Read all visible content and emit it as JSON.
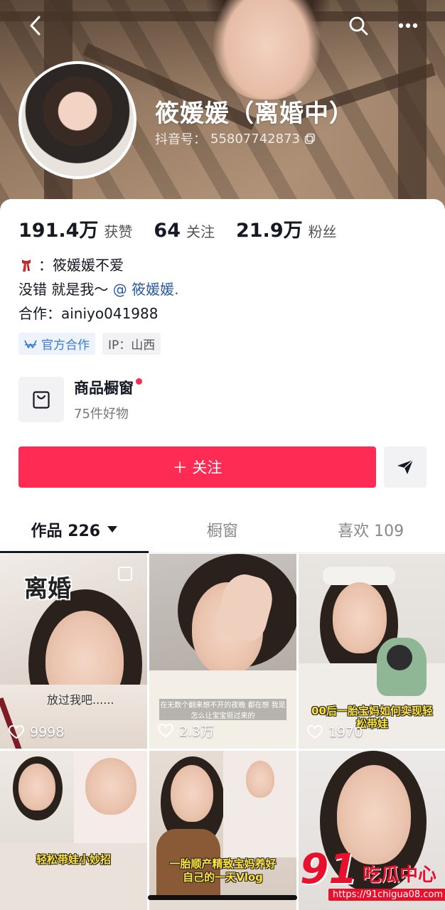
{
  "profile": {
    "name": "筱媛媛（离婚中）",
    "douyin_id_label": "抖音号：",
    "douyin_id": "55807742873"
  },
  "stats": [
    {
      "num": "191.4万",
      "label": "获赞"
    },
    {
      "num": "64",
      "label": "关注"
    },
    {
      "num": "21.9万",
      "label": "粉丝"
    }
  ],
  "bio": {
    "line1": "：筱媛媛不爱",
    "line2_text": "没错 就是我～",
    "line2_mention": "@ 筱媛媛.",
    "line3": "合作：ainiyo041988"
  },
  "tags": {
    "official": "官方合作",
    "ip": "IP：山西"
  },
  "shop": {
    "title": "商品橱窗",
    "subtitle": "75件好物"
  },
  "actions": {
    "follow": "＋ 关注"
  },
  "tabs": [
    {
      "label": "作品 226"
    },
    {
      "label": "橱窗"
    },
    {
      "label": "喜欢 109"
    }
  ],
  "videos": [
    {
      "title": "离婚",
      "caption": "放过我吧......",
      "likes": "9998"
    },
    {
      "caption": "在无数个翻来想不开的夜晚 都在想 我是怎么让宝宝挺过来的",
      "likes": "2.3万"
    },
    {
      "caption": "00后一胎宝妈如何实现轻松带娃",
      "likes": "1970"
    },
    {
      "caption": "轻松带娃小妙招"
    },
    {
      "caption": "一胎顺产精致宝妈养好自己的一天Vlog"
    },
    {
      "caption": ""
    }
  ],
  "watermark": {
    "brand_num": "91",
    "brand_cn": "吃瓜中心",
    "url": "https://91chigua08.com"
  },
  "colors": {
    "accent": "#fe2c55",
    "mention": "#2b5b9c",
    "official": "#3a7bd5"
  }
}
